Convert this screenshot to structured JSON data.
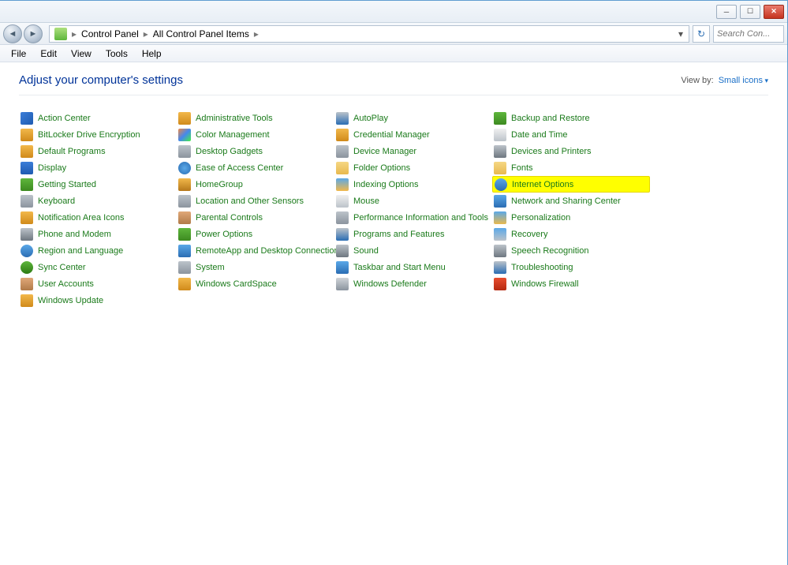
{
  "titlebar": {
    "minimize": "─",
    "maximize": "☐",
    "close": "✕"
  },
  "address": {
    "back": "◄",
    "forward": "►",
    "crumbs": [
      "Control Panel",
      "All Control Panel Items"
    ],
    "sep": "▸",
    "dropdown": "▾",
    "refresh": "↻"
  },
  "search": {
    "placeholder": "Search Con..."
  },
  "menu": [
    "File",
    "Edit",
    "View",
    "Tools",
    "Help"
  ],
  "heading": "Adjust your computer's settings",
  "viewby": {
    "label": "View by:",
    "value": "Small icons"
  },
  "items": [
    {
      "label": "Action Center",
      "icon": "ic-flag"
    },
    {
      "label": "BitLocker Drive Encryption",
      "icon": "ic-lock"
    },
    {
      "label": "Default Programs",
      "icon": "ic-star"
    },
    {
      "label": "Display",
      "icon": "ic-monitor"
    },
    {
      "label": "Getting Started",
      "icon": "ic-book"
    },
    {
      "label": "Keyboard",
      "icon": "ic-keyboard"
    },
    {
      "label": "Notification Area Icons",
      "icon": "ic-bell"
    },
    {
      "label": "Phone and Modem",
      "icon": "ic-phone"
    },
    {
      "label": "Region and Language",
      "icon": "ic-globe"
    },
    {
      "label": "Sync Center",
      "icon": "ic-sync"
    },
    {
      "label": "User Accounts",
      "icon": "ic-users"
    },
    {
      "label": "Windows Update",
      "icon": "ic-update"
    },
    {
      "label": "Administrative Tools",
      "icon": "ic-admin"
    },
    {
      "label": "Color Management",
      "icon": "ic-color"
    },
    {
      "label": "Desktop Gadgets",
      "icon": "ic-gadget"
    },
    {
      "label": "Ease of Access Center",
      "icon": "ic-ease"
    },
    {
      "label": "HomeGroup",
      "icon": "ic-home"
    },
    {
      "label": "Location and Other Sensors",
      "icon": "ic-location"
    },
    {
      "label": "Parental Controls",
      "icon": "ic-parental"
    },
    {
      "label": "Power Options",
      "icon": "ic-power"
    },
    {
      "label": "RemoteApp and Desktop Connections",
      "icon": "ic-remote"
    },
    {
      "label": "System",
      "icon": "ic-system"
    },
    {
      "label": "Windows CardSpace",
      "icon": "ic-card"
    },
    {
      "label": ""
    },
    {
      "label": "AutoPlay",
      "icon": "ic-autoplay"
    },
    {
      "label": "Credential Manager",
      "icon": "ic-cred"
    },
    {
      "label": "Device Manager",
      "icon": "ic-device"
    },
    {
      "label": "Folder Options",
      "icon": "ic-folder"
    },
    {
      "label": "Indexing Options",
      "icon": "ic-index"
    },
    {
      "label": "Mouse",
      "icon": "ic-mouse"
    },
    {
      "label": "Performance Information and Tools",
      "icon": "ic-perf"
    },
    {
      "label": "Programs and Features",
      "icon": "ic-programs"
    },
    {
      "label": "Sound",
      "icon": "ic-sound"
    },
    {
      "label": "Taskbar and Start Menu",
      "icon": "ic-taskbar"
    },
    {
      "label": "Windows Defender",
      "icon": "ic-defender"
    },
    {
      "label": ""
    },
    {
      "label": "Backup and Restore",
      "icon": "ic-backup"
    },
    {
      "label": "Date and Time",
      "icon": "ic-date"
    },
    {
      "label": "Devices and Printers",
      "icon": "ic-devprint"
    },
    {
      "label": "Fonts",
      "icon": "ic-fonts"
    },
    {
      "label": "Internet Options",
      "icon": "ic-internet",
      "highlight": true
    },
    {
      "label": "Network and Sharing Center",
      "icon": "ic-network"
    },
    {
      "label": "Personalization",
      "icon": "ic-personal"
    },
    {
      "label": "Recovery",
      "icon": "ic-recovery"
    },
    {
      "label": "Speech Recognition",
      "icon": "ic-speech"
    },
    {
      "label": "Troubleshooting",
      "icon": "ic-trouble"
    },
    {
      "label": "Windows Firewall",
      "icon": "ic-firewall"
    },
    {
      "label": ""
    }
  ]
}
